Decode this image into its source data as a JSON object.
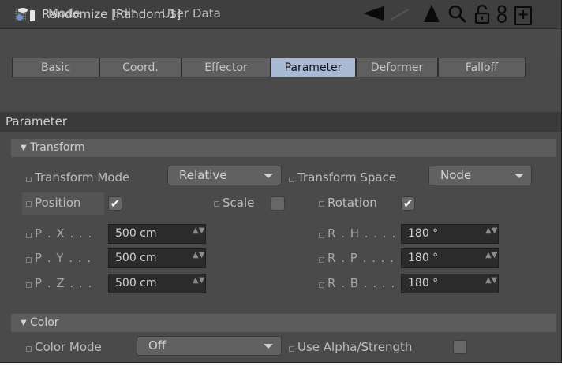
{
  "menubar": {
    "items": [
      "Mode",
      "Edit",
      "User Data"
    ],
    "icons": [
      "arrow-left-icon",
      "arrow-up-icon",
      "search-icon",
      "lock-icon",
      "node-icon",
      "add-panel-icon"
    ],
    "add_glyph": "+"
  },
  "object": {
    "title": "Randomize [Random.1]"
  },
  "tabs": [
    {
      "label": "Basic",
      "active": false
    },
    {
      "label": "Coord.",
      "active": false
    },
    {
      "label": "Effector",
      "active": false
    },
    {
      "label": "Parameter",
      "active": true
    },
    {
      "label": "Deformer",
      "active": false
    },
    {
      "label": "Falloff",
      "active": false
    }
  ],
  "parameter": {
    "header": "Parameter",
    "transform": {
      "header": "Transform",
      "mode_label": "Transform Mode",
      "mode_value": "Relative",
      "space_label": "Transform Space",
      "space_value": "Node",
      "position_label": "Position",
      "position_checked": true,
      "scale_label": "Scale",
      "scale_checked": false,
      "rotation_label": "Rotation",
      "rotation_checked": true,
      "check_glyph": "✔",
      "spin_glyph": "▲▼",
      "px": {
        "label": "P . X . . .",
        "value": "500 cm"
      },
      "py": {
        "label": "P . Y . . .",
        "value": "500 cm"
      },
      "pz": {
        "label": "P . Z . . .",
        "value": "500 cm"
      },
      "rh": {
        "label": "R . H . . . .",
        "value": "180 °"
      },
      "rp": {
        "label": "R . P . . . .",
        "value": "180 °"
      },
      "rb": {
        "label": "R . B . . . .",
        "value": "180 °"
      }
    },
    "color": {
      "header": "Color",
      "mode_label": "Color Mode",
      "mode_value": "Off",
      "alpha_label": "Use Alpha/Strength",
      "alpha_checked": false
    }
  },
  "colors": {
    "panel_bg": "#4a4a4a",
    "active_tab": "#a9bad4",
    "field_bg": "#2b2b2b"
  }
}
